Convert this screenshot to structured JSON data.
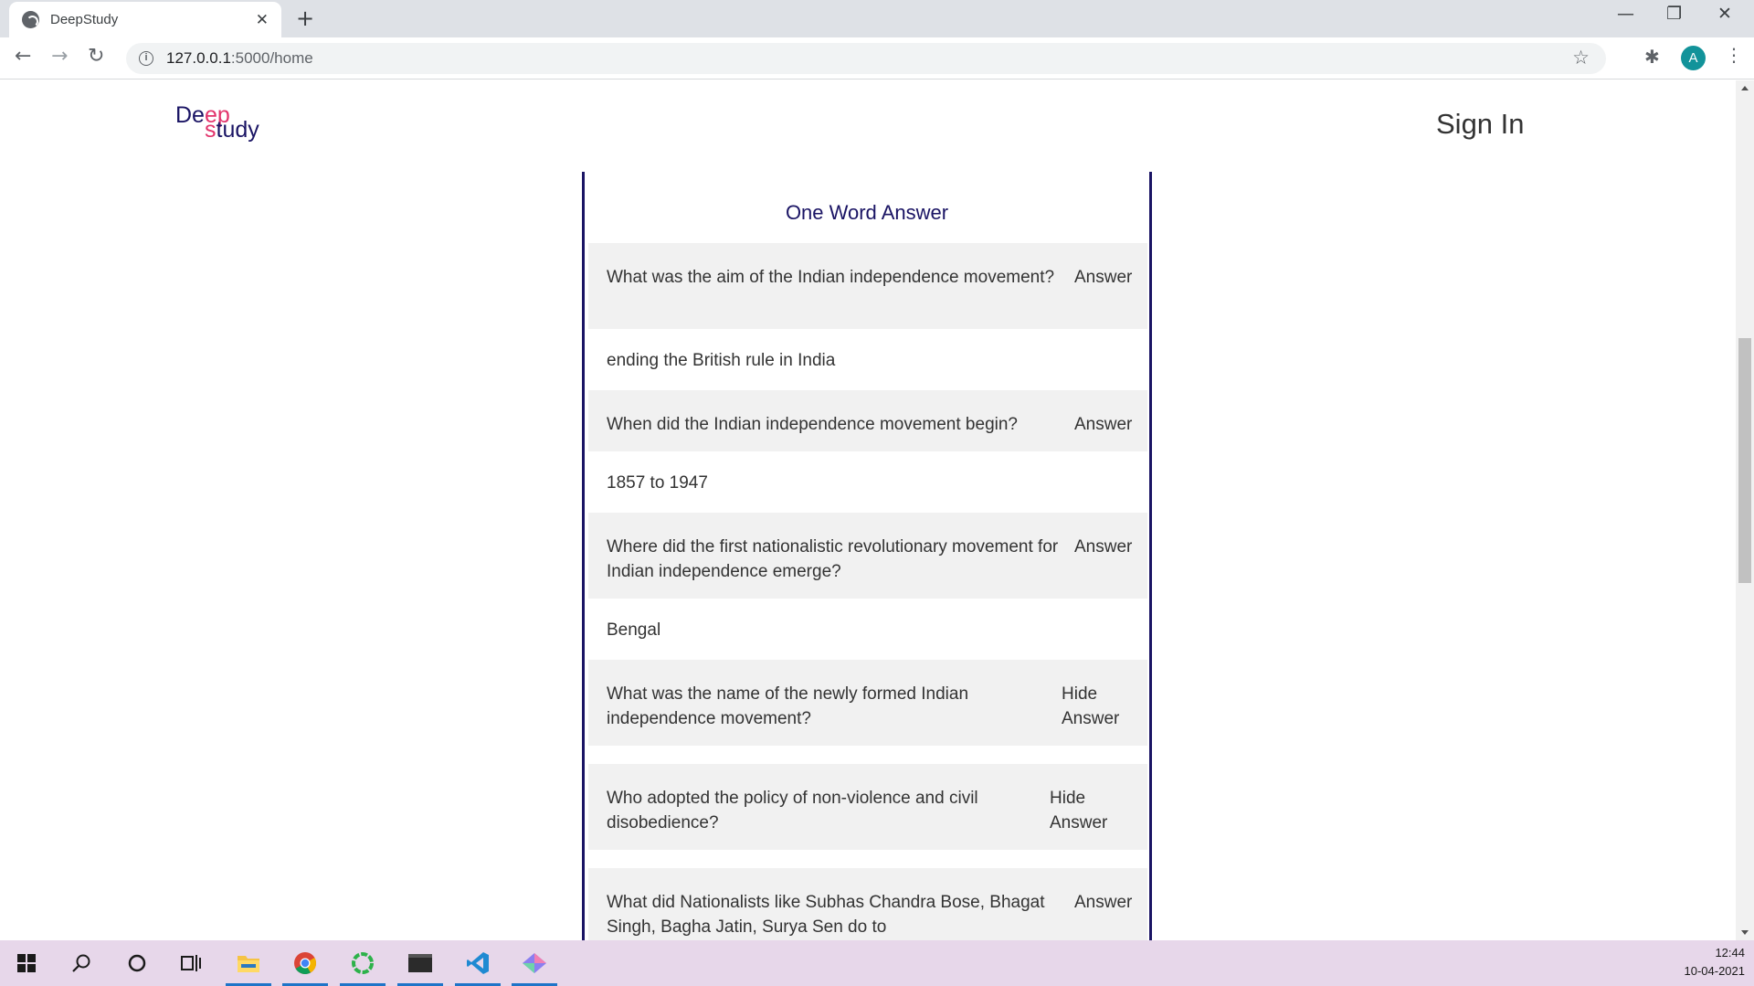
{
  "browser": {
    "tab_title": "DeepStudy",
    "tab_close": "✕",
    "new_tab": "+",
    "url_host": "127.0.0.1",
    "url_path": ":5000/home",
    "avatar_letter": "A",
    "window_min": "—",
    "window_restore": "❐",
    "window_close": "✕"
  },
  "header": {
    "logo_deep_1": "De",
    "logo_deep_2": "ep",
    "logo_study_1": "s",
    "logo_study_2": "tudy",
    "signin": "Sign In"
  },
  "card": {
    "title": "One Word Answer",
    "items": [
      {
        "question": "What was the aim of the Indian independence movement?",
        "button": "Answer",
        "answer": "ending the British rule in India"
      },
      {
        "question": "When did the Indian independence movement begin?",
        "button": "Answer",
        "answer": "1857 to 1947"
      },
      {
        "question": "Where did the first nationalistic revolutionary movement for Indian independence emerge?",
        "button": "Answer",
        "answer": "Bengal"
      },
      {
        "question": "What was the name of the newly formed Indian independence movement?",
        "button": "Hide Answer",
        "answer": ""
      },
      {
        "question": "Who adopted the policy of non-violence and civil disobedience?",
        "button": "Hide Answer",
        "answer": ""
      },
      {
        "question": "What did Nationalists like Subhas Chandra Bose, Bhagat Singh, Bagha Jatin, Surya Sen do to",
        "button": "Answer",
        "answer": ""
      }
    ]
  },
  "taskbar": {
    "time": "12:44",
    "date": "10-04-2021"
  },
  "colors": {
    "brand_navy": "#1a1464",
    "brand_pink": "#e2336b",
    "row_gray": "#f1f1f1",
    "taskbar": "#e7d7ea"
  }
}
